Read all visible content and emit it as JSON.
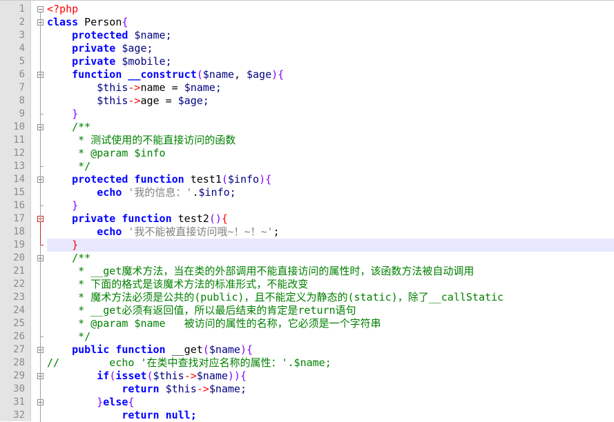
{
  "colors": {
    "keyword": "#0000ff",
    "keyword_bold": "#0000ff",
    "variable": "#000080",
    "string": "#808080",
    "comment": "#008000",
    "php_tag": "#ff0000",
    "plain": "#000000",
    "brace": "#8000ff",
    "red_brace": "#ff0000",
    "current_line_bg": "#e8e8ff"
  },
  "current_line": 19,
  "lines": [
    {
      "n": "1",
      "fold": "open",
      "tokens": [
        {
          "t": "<?php",
          "c": "php_tag"
        }
      ]
    },
    {
      "n": "2",
      "fold": "open",
      "tokens": [
        {
          "t": "class",
          "c": "keyword_bold"
        },
        {
          "t": " Person",
          "c": "plain"
        },
        {
          "t": "{",
          "c": "brace"
        }
      ]
    },
    {
      "n": "3",
      "tokens": [
        {
          "t": "    ",
          "c": "plain"
        },
        {
          "t": "protected",
          "c": "keyword_bold"
        },
        {
          "t": " $name;",
          "c": "variable"
        }
      ]
    },
    {
      "n": "4",
      "tokens": [
        {
          "t": "    ",
          "c": "plain"
        },
        {
          "t": "private",
          "c": "keyword_bold"
        },
        {
          "t": " $age;",
          "c": "variable"
        }
      ]
    },
    {
      "n": "5",
      "tokens": [
        {
          "t": "    ",
          "c": "plain"
        },
        {
          "t": "private",
          "c": "keyword_bold"
        },
        {
          "t": " $mobile;",
          "c": "variable"
        }
      ]
    },
    {
      "n": "6",
      "fold": "open",
      "tokens": [
        {
          "t": "    ",
          "c": "plain"
        },
        {
          "t": "function",
          "c": "keyword_bold"
        },
        {
          "t": " __construct",
          "c": "keyword_bold"
        },
        {
          "t": "(",
          "c": "brace"
        },
        {
          "t": "$name",
          "c": "variable"
        },
        {
          "t": ", ",
          "c": "plain"
        },
        {
          "t": "$age",
          "c": "variable"
        },
        {
          "t": "){",
          "c": "brace"
        }
      ]
    },
    {
      "n": "7",
      "tokens": [
        {
          "t": "        ",
          "c": "plain"
        },
        {
          "t": "$this",
          "c": "variable"
        },
        {
          "t": "->",
          "c": "php_tag"
        },
        {
          "t": "name",
          "c": "plain"
        },
        {
          "t": " = ",
          "c": "plain"
        },
        {
          "t": "$name;",
          "c": "variable"
        }
      ]
    },
    {
      "n": "8",
      "tokens": [
        {
          "t": "        ",
          "c": "plain"
        },
        {
          "t": "$this",
          "c": "variable"
        },
        {
          "t": "->",
          "c": "php_tag"
        },
        {
          "t": "age",
          "c": "plain"
        },
        {
          "t": " = ",
          "c": "plain"
        },
        {
          "t": "$age;",
          "c": "variable"
        }
      ]
    },
    {
      "n": "9",
      "fold": "end",
      "tokens": [
        {
          "t": "    ",
          "c": "plain"
        },
        {
          "t": "}",
          "c": "brace"
        }
      ]
    },
    {
      "n": "10",
      "fold": "open",
      "tokens": [
        {
          "t": "    /**",
          "c": "comment"
        }
      ]
    },
    {
      "n": "11",
      "tokens": [
        {
          "t": "     * 测试使用的不能直接访问的函数",
          "c": "comment"
        }
      ]
    },
    {
      "n": "12",
      "tokens": [
        {
          "t": "     * @param $info",
          "c": "comment"
        }
      ]
    },
    {
      "n": "13",
      "fold": "end",
      "tokens": [
        {
          "t": "     */",
          "c": "comment"
        }
      ]
    },
    {
      "n": "14",
      "fold": "open",
      "tokens": [
        {
          "t": "    ",
          "c": "plain"
        },
        {
          "t": "protected",
          "c": "keyword_bold"
        },
        {
          "t": " function",
          "c": "keyword_bold"
        },
        {
          "t": " test1",
          "c": "plain"
        },
        {
          "t": "(",
          "c": "brace"
        },
        {
          "t": "$info",
          "c": "variable"
        },
        {
          "t": "){",
          "c": "brace"
        }
      ]
    },
    {
      "n": "15",
      "tokens": [
        {
          "t": "        ",
          "c": "plain"
        },
        {
          "t": "echo",
          "c": "keyword_bold"
        },
        {
          "t": " '我的信息：'",
          "c": "string"
        },
        {
          "t": ".",
          "c": "plain"
        },
        {
          "t": "$info;",
          "c": "variable"
        }
      ]
    },
    {
      "n": "16",
      "fold": "end",
      "tokens": [
        {
          "t": "    ",
          "c": "plain"
        },
        {
          "t": "}",
          "c": "brace"
        }
      ]
    },
    {
      "n": "17",
      "fold": "open-red",
      "tokens": [
        {
          "t": "    ",
          "c": "plain"
        },
        {
          "t": "private",
          "c": "keyword_bold"
        },
        {
          "t": " function",
          "c": "keyword_bold"
        },
        {
          "t": " test2",
          "c": "plain"
        },
        {
          "t": "()",
          "c": "brace"
        },
        {
          "t": "{",
          "c": "red_brace"
        }
      ]
    },
    {
      "n": "18",
      "tokens": [
        {
          "t": "        ",
          "c": "plain"
        },
        {
          "t": "echo",
          "c": "keyword_bold"
        },
        {
          "t": " '我不能被直接访问哦~！~！~'",
          "c": "string"
        },
        {
          "t": ";",
          "c": "plain"
        }
      ]
    },
    {
      "n": "19",
      "fold": "end-red",
      "tokens": [
        {
          "t": "    ",
          "c": "plain"
        },
        {
          "t": "}",
          "c": "red_brace"
        }
      ]
    },
    {
      "n": "20",
      "fold": "open",
      "tokens": [
        {
          "t": "    /**",
          "c": "comment"
        }
      ]
    },
    {
      "n": "21",
      "tokens": [
        {
          "t": "     * __get魔术方法，当在类的外部调用不能直接访问的属性时，该函数方法被自动调用",
          "c": "comment"
        }
      ]
    },
    {
      "n": "22",
      "tokens": [
        {
          "t": "     * 下面的格式是该魔术方法的标准形式，不能改变",
          "c": "comment"
        }
      ]
    },
    {
      "n": "23",
      "tokens": [
        {
          "t": "     * 魔术方法必须是公共的(public)，且不能定义为静态的(static)，除了__callStatic",
          "c": "comment"
        }
      ]
    },
    {
      "n": "24",
      "tokens": [
        {
          "t": "     * __get必须有返回值，所以最后结束的肯定是return语句",
          "c": "comment"
        }
      ]
    },
    {
      "n": "25",
      "tokens": [
        {
          "t": "     * @param $name   被访问的属性的名称，它必须是一个字符串",
          "c": "comment"
        }
      ]
    },
    {
      "n": "26",
      "fold": "end",
      "tokens": [
        {
          "t": "     */",
          "c": "comment"
        }
      ]
    },
    {
      "n": "27",
      "fold": "open",
      "tokens": [
        {
          "t": "    ",
          "c": "plain"
        },
        {
          "t": "public",
          "c": "keyword_bold"
        },
        {
          "t": " function",
          "c": "keyword_bold"
        },
        {
          "t": " __get",
          "c": "plain"
        },
        {
          "t": "(",
          "c": "brace"
        },
        {
          "t": "$name",
          "c": "variable"
        },
        {
          "t": "){",
          "c": "brace"
        }
      ]
    },
    {
      "n": "28",
      "tokens": [
        {
          "t": "//        echo '在类中查找对应名称的属性：'.$name;",
          "c": "comment"
        }
      ]
    },
    {
      "n": "29",
      "fold": "open",
      "tokens": [
        {
          "t": "        ",
          "c": "plain"
        },
        {
          "t": "if",
          "c": "keyword_bold"
        },
        {
          "t": "(",
          "c": "brace"
        },
        {
          "t": "isset",
          "c": "keyword_bold"
        },
        {
          "t": "(",
          "c": "brace"
        },
        {
          "t": "$this",
          "c": "variable"
        },
        {
          "t": "->",
          "c": "php_tag"
        },
        {
          "t": "$name",
          "c": "variable"
        },
        {
          "t": ")){",
          "c": "brace"
        }
      ]
    },
    {
      "n": "30",
      "tokens": [
        {
          "t": "            ",
          "c": "plain"
        },
        {
          "t": "return",
          "c": "keyword_bold"
        },
        {
          "t": " $this",
          "c": "variable"
        },
        {
          "t": "->",
          "c": "php_tag"
        },
        {
          "t": "$name;",
          "c": "variable"
        }
      ]
    },
    {
      "n": "31",
      "fold": "else",
      "tokens": [
        {
          "t": "        ",
          "c": "plain"
        },
        {
          "t": "}",
          "c": "brace"
        },
        {
          "t": "else",
          "c": "keyword_bold"
        },
        {
          "t": "{",
          "c": "brace"
        }
      ]
    },
    {
      "n": "32",
      "tokens": [
        {
          "t": "            ",
          "c": "plain"
        },
        {
          "t": "return",
          "c": "keyword_bold"
        },
        {
          "t": " null;",
          "c": "keyword_bold"
        }
      ]
    }
  ]
}
